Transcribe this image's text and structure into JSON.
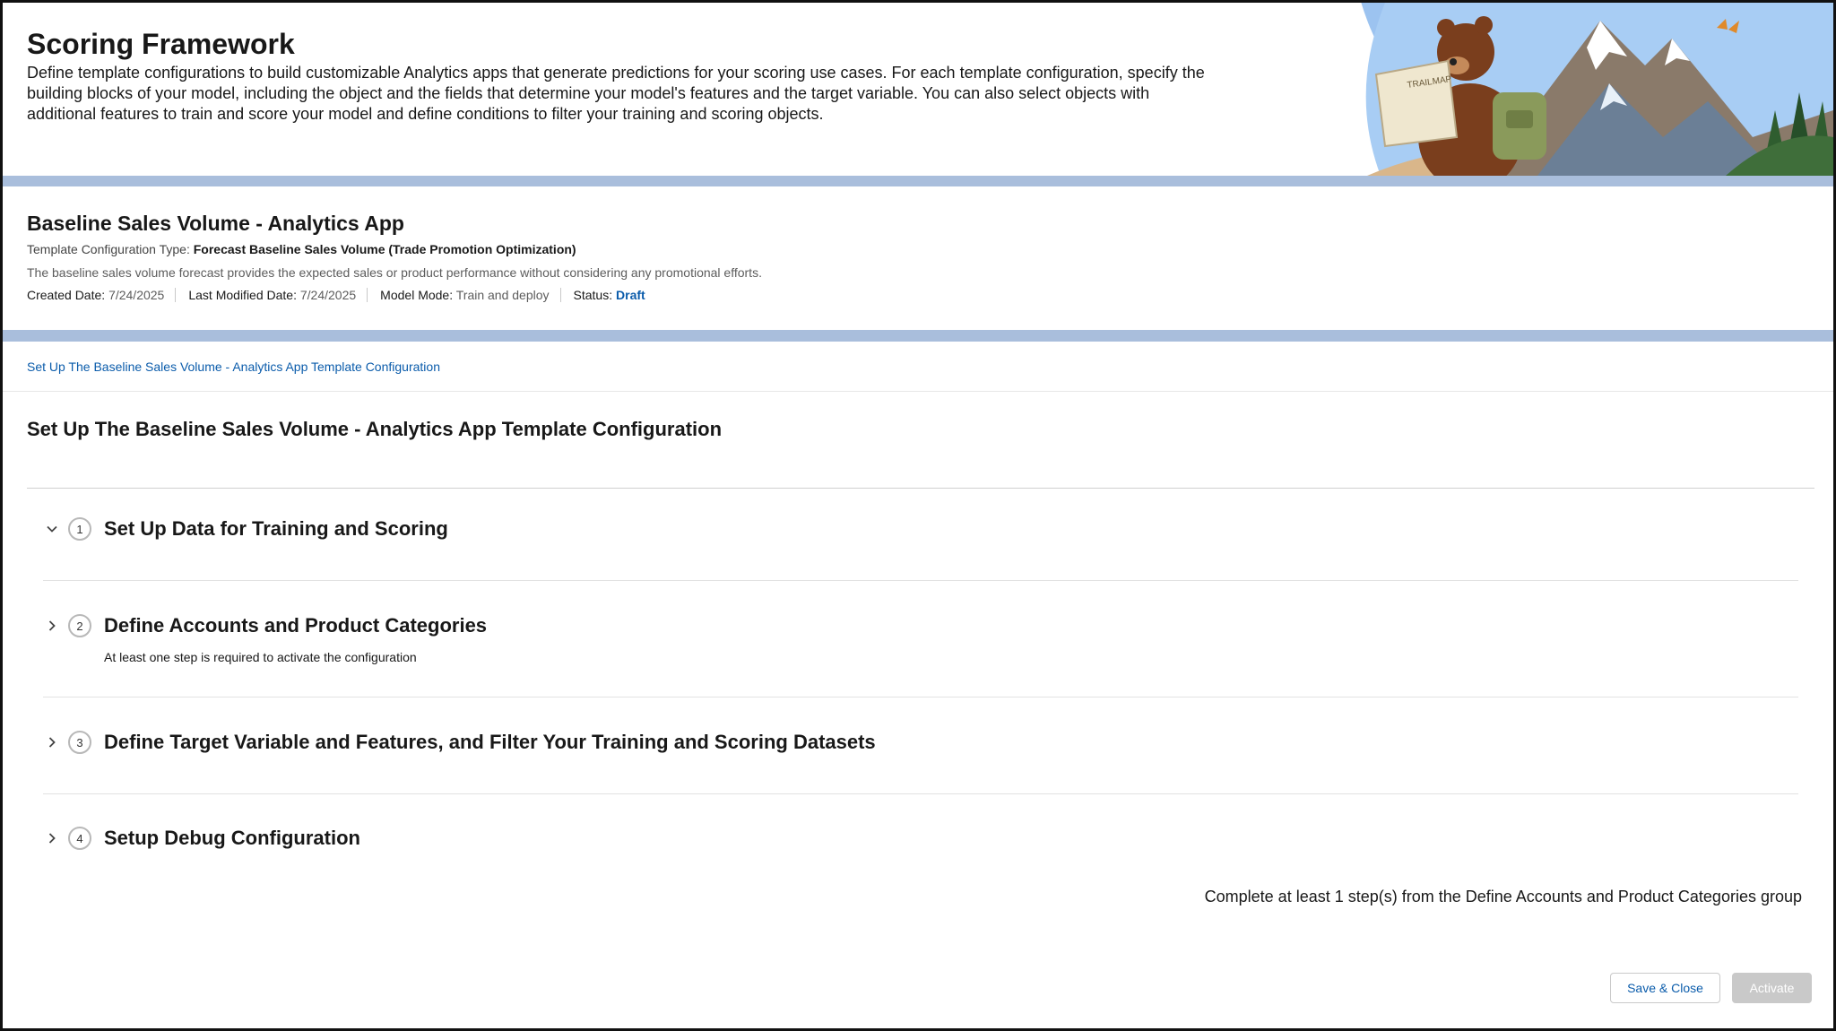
{
  "banner": {
    "title": "Scoring Framework",
    "description": "Define template configurations to build customizable Analytics apps that generate predictions for your scoring use cases. For each template configuration, specify the building blocks of your model, including the object and the fields that determine your model's features and the target variable. You can also select objects with additional features to train and score your model and define conditions to filter your training and scoring objects.",
    "sign_text": "TRAILMAP"
  },
  "record": {
    "title": "Baseline Sales Volume - Analytics App",
    "type_label": "Template Configuration Type:",
    "type_value": "Forecast Baseline Sales Volume (Trade Promotion Optimization)",
    "description": "The baseline sales volume forecast provides the expected sales or product performance without considering any promotional efforts.",
    "created_label": "Created Date:",
    "created_value": "7/24/2025",
    "modified_label": "Last Modified Date:",
    "modified_value": "7/24/2025",
    "mode_label": "Model Mode:",
    "mode_value": "Train and deploy",
    "status_label": "Status:",
    "status_value": "Draft"
  },
  "main": {
    "breadcrumb": "Set Up The Baseline Sales Volume - Analytics App Template Configuration",
    "heading": "Set Up The Baseline Sales Volume - Analytics App Template Configuration",
    "steps": [
      {
        "number": "1",
        "title": "Set Up Data for Training and Scoring",
        "subtitle": "",
        "expanded": true
      },
      {
        "number": "2",
        "title": "Define Accounts and Product Categories",
        "subtitle": "At least one step is required to activate the configuration",
        "expanded": false
      },
      {
        "number": "3",
        "title": "Define Target Variable and Features, and Filter Your Training and Scoring Datasets",
        "subtitle": "",
        "expanded": false
      },
      {
        "number": "4",
        "title": "Setup Debug Configuration",
        "subtitle": "",
        "expanded": false
      }
    ],
    "hint": "Complete at least 1 step(s) from the Define Accounts and Product Categories group"
  },
  "footer": {
    "save_label": "Save & Close",
    "activate_label": "Activate"
  },
  "colors": {
    "link": "#0b5cab",
    "stripe": "#a9bedc",
    "disabled_button": "#c9c9c9"
  },
  "icons": {
    "expanded": "chevron-down-icon",
    "collapsed": "chevron-right-icon"
  }
}
